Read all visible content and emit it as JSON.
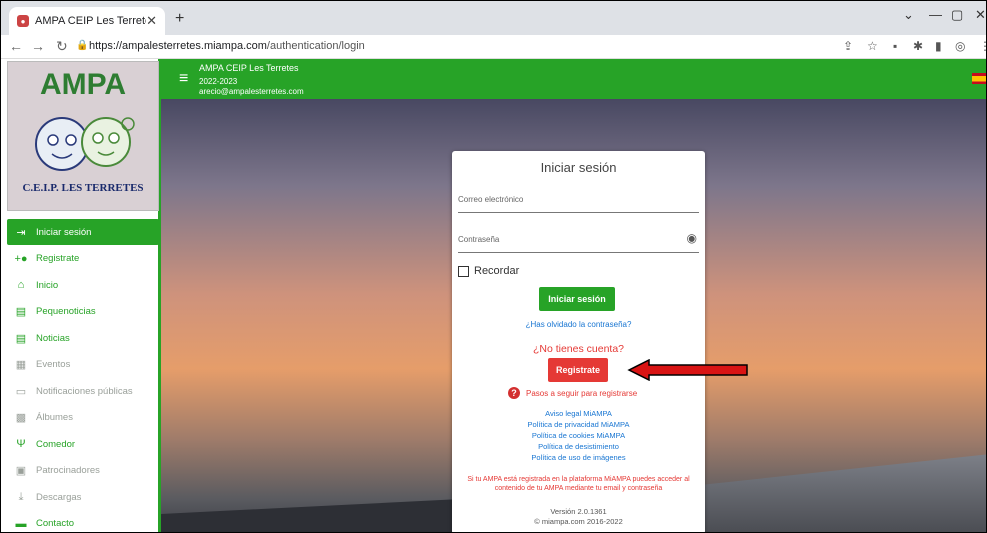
{
  "browser": {
    "tab_title": "AMPA CEIP Les Terretes",
    "url_host": "https://ampalesterretes.miampa.com",
    "url_path": "/authentication/login"
  },
  "header": {
    "title": "AMPA CEIP Les Terretes",
    "year": "2022-2023",
    "email": "arecio@ampalesterretes.com"
  },
  "logo": {
    "text": "AMPA",
    "subtitle": "C.E.I.P. LES TERRETES"
  },
  "sidebar": {
    "items": [
      {
        "label": "Iniciar sesión",
        "icon": "login-icon"
      },
      {
        "label": "Registrate",
        "icon": "person-add-icon"
      },
      {
        "label": "Inicio",
        "icon": "home-icon"
      },
      {
        "label": "Pequenoticias",
        "icon": "news-icon"
      },
      {
        "label": "Noticias",
        "icon": "news-icon"
      },
      {
        "label": "Eventos",
        "icon": "calendar-icon"
      },
      {
        "label": "Notificaciones públicas",
        "icon": "message-icon"
      },
      {
        "label": "Álbumes",
        "icon": "image-icon"
      },
      {
        "label": "Comedor",
        "icon": "cutlery-icon"
      },
      {
        "label": "Patrocinadores",
        "icon": "store-icon"
      },
      {
        "label": "Descargas",
        "icon": "download-icon"
      },
      {
        "label": "Contacto",
        "icon": "contact-icon"
      }
    ]
  },
  "login": {
    "title": "Iniciar sesión",
    "email_placeholder": "Correo electrónico",
    "password_placeholder": "Contraseña",
    "remember_label": "Recordar",
    "login_button": "Iniciar sesión",
    "forgot_link": "¿Has olvidado la contraseña?",
    "no_account": "¿No tienes cuenta?",
    "register_button": "Registrate",
    "steps_link": "Pasos a seguir para registrarse",
    "links": [
      "Aviso legal MiAMPA",
      "Política de privacidad MiAMPA",
      "Política de cookies MiAMPA",
      "Política de desistimiento",
      "Política de uso de imágenes"
    ],
    "notice": "Si tu AMPA está registrada en la plataforma MiAMPA puedes acceder al contenido de tu AMPA mediante tu email y contraseña",
    "version": "Versión 2.0.1361",
    "copyright": "© miampa.com 2016-2022"
  },
  "colors": {
    "brand_green": "#27a327",
    "accent_red": "#e53935",
    "link_blue": "#1976d2"
  }
}
